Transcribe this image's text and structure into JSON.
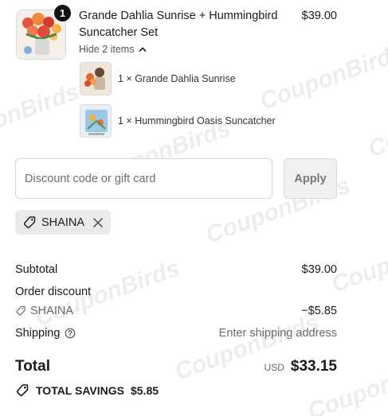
{
  "watermark_text": "CouponBirds",
  "product": {
    "quantity": "1",
    "title": "Grande Dahlia Sunrise + Hummingbird Suncatcher Set",
    "price": "$39.00",
    "toggle_label": "Hide 2 items",
    "sub_items": [
      {
        "label": "1 × Grande Dahlia Sunrise"
      },
      {
        "label": "1 × Hummingbird Oasis Suncatcher"
      }
    ]
  },
  "discount": {
    "placeholder": "Discount code or gift card",
    "value": "",
    "apply_label": "Apply",
    "applied_code": "SHAINA"
  },
  "summary": {
    "subtotal_label": "Subtotal",
    "subtotal_value": "$39.00",
    "order_discount_label": "Order discount",
    "discount_code": "SHAINA",
    "discount_value": "−$5.85",
    "shipping_label": "Shipping",
    "shipping_value": "Enter shipping address",
    "total_label": "Total",
    "currency": "USD",
    "total_value": "$33.15",
    "savings_label": "TOTAL SAVINGS",
    "savings_value": "$5.85"
  },
  "icons": {
    "tag": "tag-icon",
    "close": "close-icon",
    "chevron_up": "chevron-up-icon",
    "help": "question-circle-icon"
  },
  "colors": {
    "text": "#1a1a1a",
    "muted": "#6b6b6b",
    "chip_bg": "#ebebeb",
    "apply_bg": "#f0f0f0",
    "badge_bg": "#111111"
  }
}
